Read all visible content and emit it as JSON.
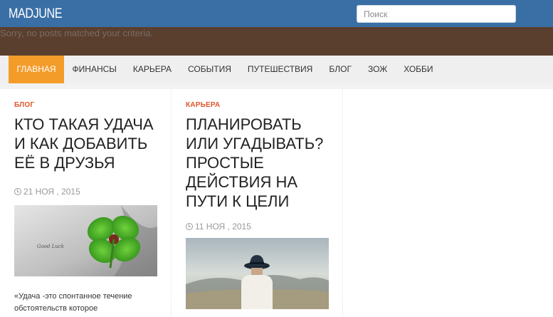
{
  "header": {
    "logo": "MADJUNE",
    "search_placeholder": "Поиск"
  },
  "banner": {
    "text": "Sorry, no posts matched your criteria."
  },
  "nav": {
    "items": [
      {
        "label": "ГЛАВНАЯ",
        "active": true
      },
      {
        "label": "ФИНАНСЫ",
        "active": false
      },
      {
        "label": "КАРЬЕРА",
        "active": false
      },
      {
        "label": "СОБЫТИЯ",
        "active": false
      },
      {
        "label": "ПУТЕШЕСТВИЯ",
        "active": false
      },
      {
        "label": "БЛОГ",
        "active": false
      },
      {
        "label": "ЗОЖ",
        "active": false
      },
      {
        "label": "ХОББИ",
        "active": false
      }
    ]
  },
  "posts": [
    {
      "category": "БЛОГ",
      "title": "КТО ТАКАЯ УДАЧА И КАК ДОБАВИТЬ ЕЁ В ДРУЗЬЯ",
      "date": "21 НОЯ , 2015",
      "image_caption": "Good Luck",
      "excerpt": "«Удача -это спонтанное течение обстоятельств которое"
    },
    {
      "category": "КАРЬЕРА",
      "title": "ПЛАНИРОВАТЬ ИЛИ УГАДЫВАТЬ? ПРОСТЫЕ ДЕЙСТВИЯ НА ПУТИ К ЦЕЛИ",
      "date": "11 НОЯ , 2015"
    }
  ],
  "colors": {
    "topbar": "#3a6fa6",
    "banner": "#5a3f2e",
    "nav_active": "#f39c2a",
    "category": "#e0562b"
  },
  "icons": {
    "date": "clock-icon"
  }
}
